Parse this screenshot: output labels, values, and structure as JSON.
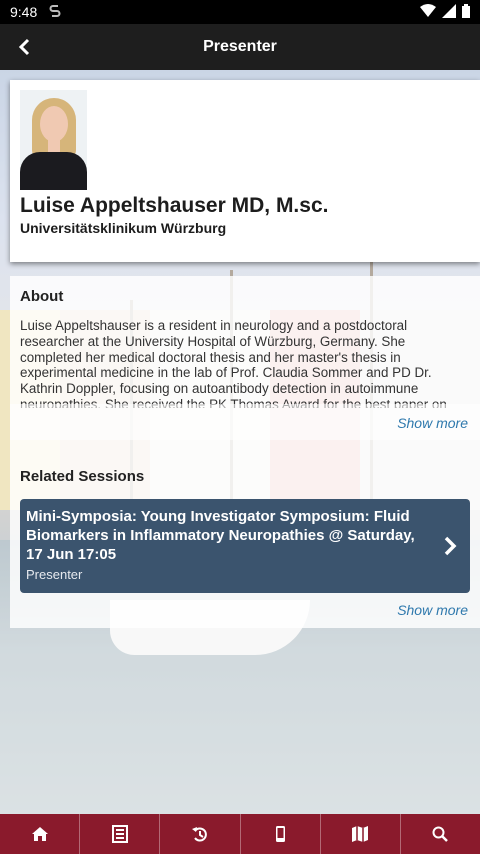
{
  "status_bar": {
    "time": "9:48"
  },
  "header": {
    "title": "Presenter"
  },
  "presenter": {
    "name": "Luise Appeltshauser MD, M.sc.",
    "affiliation": "Universitätsklinikum Würzburg"
  },
  "about": {
    "heading": "About",
    "text": "Luise Appeltshauser is a resident in neurology and a postdoctoral researcher at the University Hospital of Würzburg, Germany. She completed her medical doctoral thesis and her master's thesis in experimental medicine in the lab of Prof. Claudia Sommer and PD Dr. Kathrin Doppler, focusing on autoantibody detection in autoimmune neuropathies. She received the PK Thomas Award for the best paper on",
    "show_more": "Show more"
  },
  "related_sessions": {
    "heading": "Related Sessions",
    "items": [
      {
        "title": "Mini-Symposia: Young Investigator Symposium: Fluid Biomarkers in Inflammatory Neuropathies @ Saturday, 17 Jun 17:05",
        "role": "Presenter"
      }
    ],
    "show_more": "Show more"
  },
  "bottom_nav": {
    "items": [
      "home-icon",
      "agenda-icon",
      "history-icon",
      "mobile-icon",
      "map-icon",
      "search-icon"
    ]
  },
  "colors": {
    "header_bg": "#1e1e1e",
    "session_bg": "#3b546e",
    "bottom_nav_bg": "#8a1a2c",
    "link": "#2f79ad"
  }
}
